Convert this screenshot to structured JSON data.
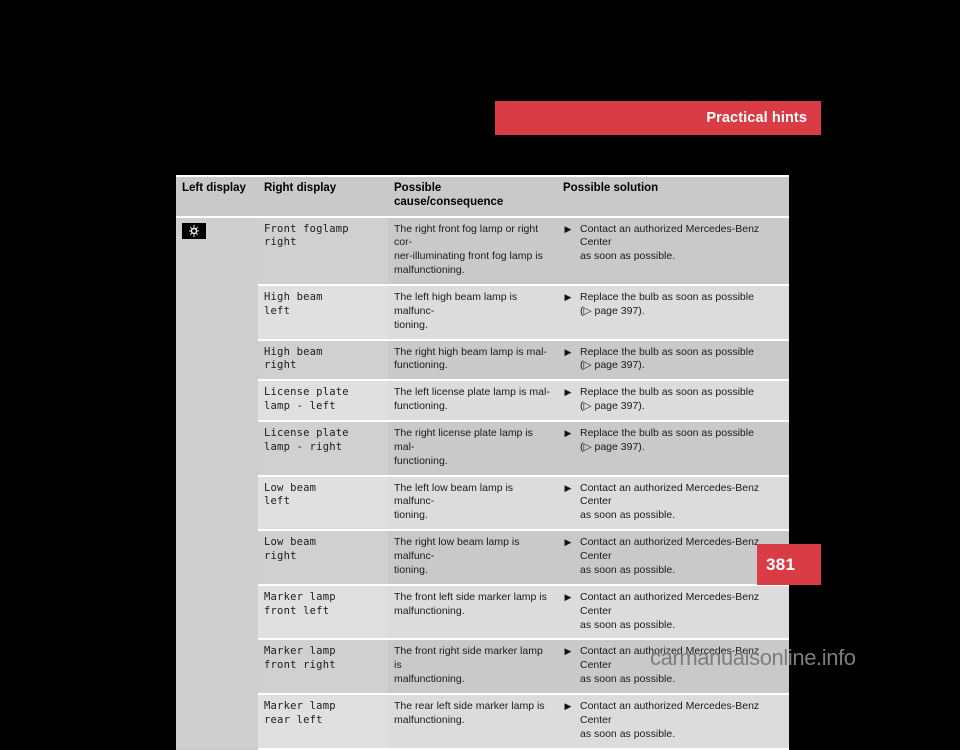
{
  "banner": {
    "title": "Practical hints"
  },
  "page_number": "381",
  "watermark": "carmanualsonline.info",
  "colors": {
    "accent_red": "#d93c45",
    "page_background": "#000000",
    "table_row_dark": "#c9c9c9",
    "table_row_light": "#dcdcdc",
    "display_text": "#8a8a8a"
  },
  "table": {
    "headers": {
      "left_display": "Left display",
      "right_display": "Right display",
      "cause": "Possible cause/consequence",
      "solution": "Possible solution"
    },
    "rows": [
      {
        "left_display_icon": "fog-lamp-indicator-icon",
        "right_display": "Front foglamp\nright",
        "cause": "The right front fog lamp or right cor-ner-illuminating front fog lamp is malfunctioning.",
        "cause_lines": "The right front fog lamp or right cor-\nner-illuminating front fog lamp is\nmalfunctioning.",
        "bullet": "▶",
        "solution": "Contact an authorized Mercedes-Benz Center\nas soon as possible."
      },
      {
        "left_display_icon": "",
        "right_display": "High beam\nleft",
        "cause_lines": "The left high beam lamp is malfunc-\ntioning.",
        "bullet": "▶",
        "solution": "Replace the bulb as soon as possible\n(▷ page 397)."
      },
      {
        "left_display_icon": "",
        "right_display": "High beam\nright",
        "cause_lines": "The right high beam lamp is mal-\nfunctioning.",
        "bullet": "▶",
        "solution": "Replace the bulb as soon as possible\n(▷ page 397)."
      },
      {
        "left_display_icon": "",
        "right_display": "License plate\nlamp - left",
        "cause_lines": "The left license plate lamp is mal-\nfunctioning.",
        "bullet": "▶",
        "solution": "Replace the bulb as soon as possible\n(▷ page 397)."
      },
      {
        "left_display_icon": "",
        "right_display": "License plate\nlamp - right",
        "cause_lines": "The right license plate lamp is mal-\nfunctioning.",
        "bullet": "▶",
        "solution": "Replace the bulb as soon as possible\n(▷ page 397)."
      },
      {
        "left_display_icon": "",
        "right_display": "Low beam\nleft",
        "cause_lines": "The left low beam lamp is malfunc-\ntioning.",
        "bullet": "▶",
        "solution": "Contact an authorized Mercedes-Benz Center\nas soon as possible."
      },
      {
        "left_display_icon": "",
        "right_display": "Low beam\nright",
        "cause_lines": "The right low beam lamp is malfunc-\ntioning.",
        "bullet": "▶",
        "solution": "Contact an authorized Mercedes-Benz Center\nas soon as possible."
      },
      {
        "left_display_icon": "",
        "right_display": "Marker lamp\nfront left",
        "cause_lines": "The front left side marker lamp is\nmalfunctioning.",
        "bullet": "▶",
        "solution": "Contact an authorized Mercedes-Benz Center\nas soon as possible."
      },
      {
        "left_display_icon": "",
        "right_display": "Marker lamp\nfront right",
        "cause_lines": "The front right side marker lamp is\nmalfunctioning.",
        "bullet": "▶",
        "solution": "Contact an authorized Mercedes-Benz Center\nas soon as possible."
      },
      {
        "left_display_icon": "",
        "right_display": "Marker lamp\nrear left",
        "cause_lines": "The rear left side marker lamp is\nmalfunctioning.",
        "bullet": "▶",
        "solution": "Contact an authorized Mercedes-Benz Center\nas soon as possible."
      }
    ]
  }
}
